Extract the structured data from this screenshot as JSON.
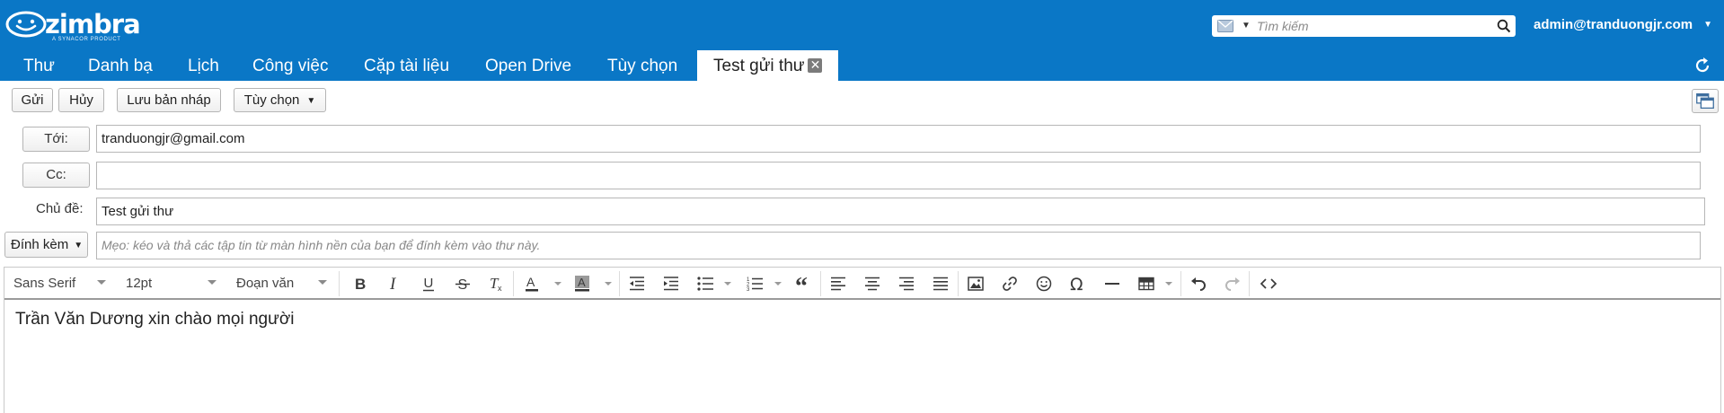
{
  "header": {
    "logo_text": "zimbra",
    "logo_subtitle": "A SYNACOR PRODUCT",
    "search": {
      "placeholder": "Tìm kiếm",
      "icon": "search-icon",
      "scope_icon": "mail-icon"
    },
    "user": "admin@tranduongjr.com"
  },
  "tabs": [
    {
      "label": "Thư"
    },
    {
      "label": "Danh bạ"
    },
    {
      "label": "Lịch"
    },
    {
      "label": "Công việc"
    },
    {
      "label": "Cặp tài liệu"
    },
    {
      "label": "Open Drive"
    },
    {
      "label": "Tùy chọn"
    },
    {
      "label": "Test gửi thư",
      "active": true,
      "closable": true
    }
  ],
  "toolbar": {
    "send": "Gửi",
    "cancel": "Hủy",
    "save_draft": "Lưu bản nháp",
    "options": "Tùy chọn"
  },
  "compose": {
    "to_label": "Tới:",
    "to_value": "tranduongjr@gmail.com",
    "cc_label": "Cc:",
    "cc_value": "",
    "subject_label": "Chủ đề:",
    "subject_value": "Test gửi thư",
    "attach_label": "Đính kèm",
    "attach_hint": "Mẹo: kéo và thả các tập tin từ màn hình nền của bạn để đính kèm vào thư này."
  },
  "editor": {
    "font_family": "Sans Serif",
    "font_size": "12pt",
    "block_format": "Đoạn văn",
    "body": "Trần Văn Dương xin chào mọi người"
  },
  "colors": {
    "brand_blue": "#0a77c6",
    "header_text": "#ffffff"
  }
}
